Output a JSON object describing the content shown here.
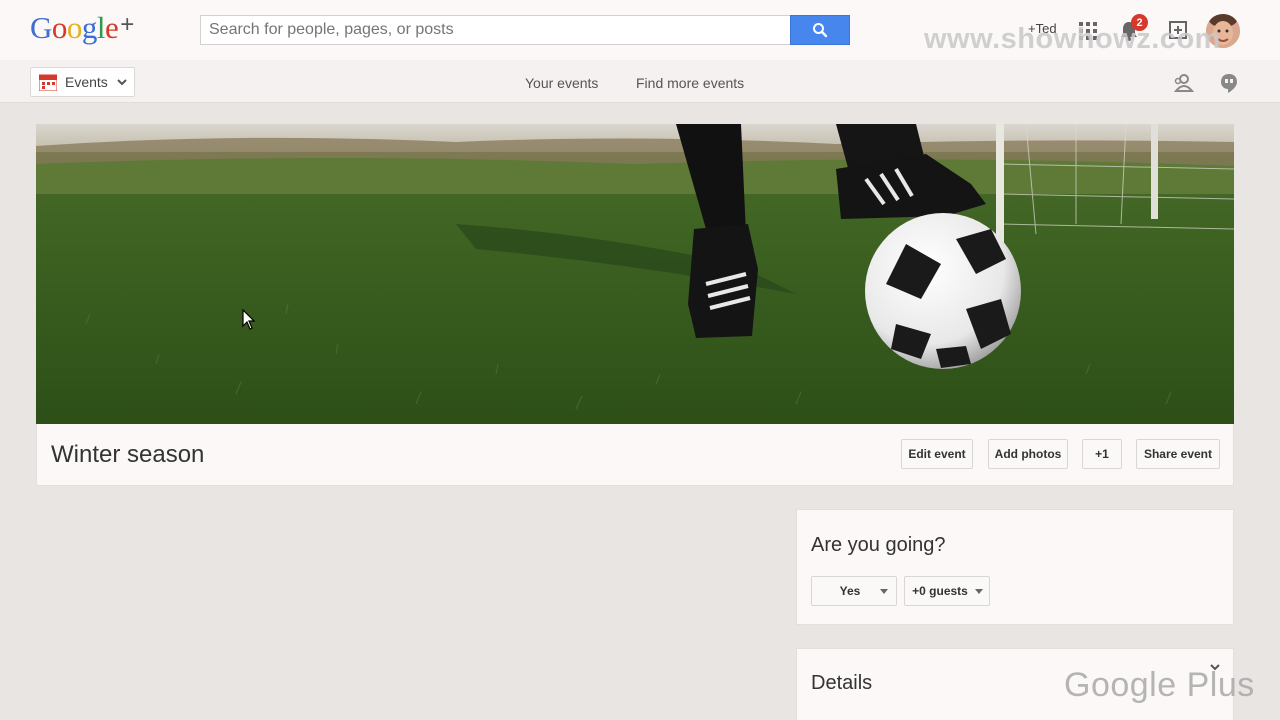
{
  "header": {
    "logo_letters": [
      "G",
      "o",
      "o",
      "g",
      "l",
      "e"
    ],
    "logo_plus": "+",
    "search_placeholder": "Search for people, pages, or posts",
    "user_name": "+Ted",
    "notification_count": "2"
  },
  "watermark": {
    "top": "www.showhowz.com",
    "bottom": "Google Plus"
  },
  "subnav": {
    "dropdown_label": "Events",
    "links": [
      "Your events",
      "Find more events"
    ]
  },
  "event": {
    "title": "Winter season",
    "buttons": [
      "Edit event",
      "Add photos",
      "+1",
      "Share event"
    ]
  },
  "rsvp": {
    "title": "Are you going?",
    "answer": "Yes",
    "guests": "+0 guests"
  },
  "details": {
    "title": "Details"
  },
  "colors": {
    "accent_blue": "#4787ed",
    "badge_red": "#d6382c",
    "background": "#e9e5e3"
  }
}
